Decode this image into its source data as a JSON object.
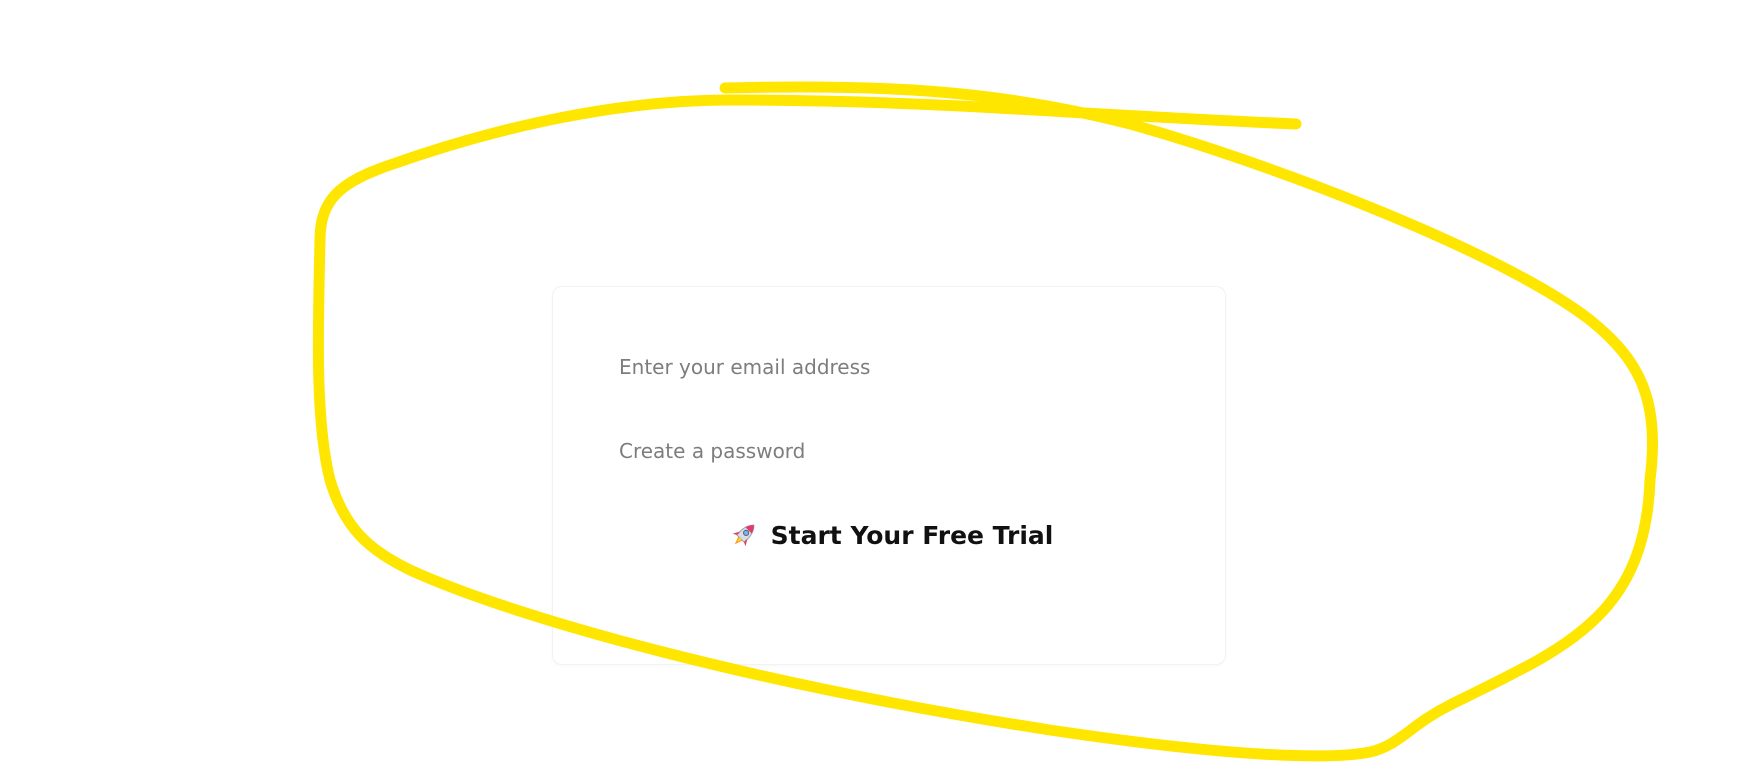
{
  "signup_form": {
    "email_placeholder": "Enter your email address",
    "password_placeholder": "Create a password",
    "submit_label": "Start Your Free Trial",
    "submit_icon": "rocket-icon"
  },
  "annotation": {
    "color": "#FFE600"
  }
}
